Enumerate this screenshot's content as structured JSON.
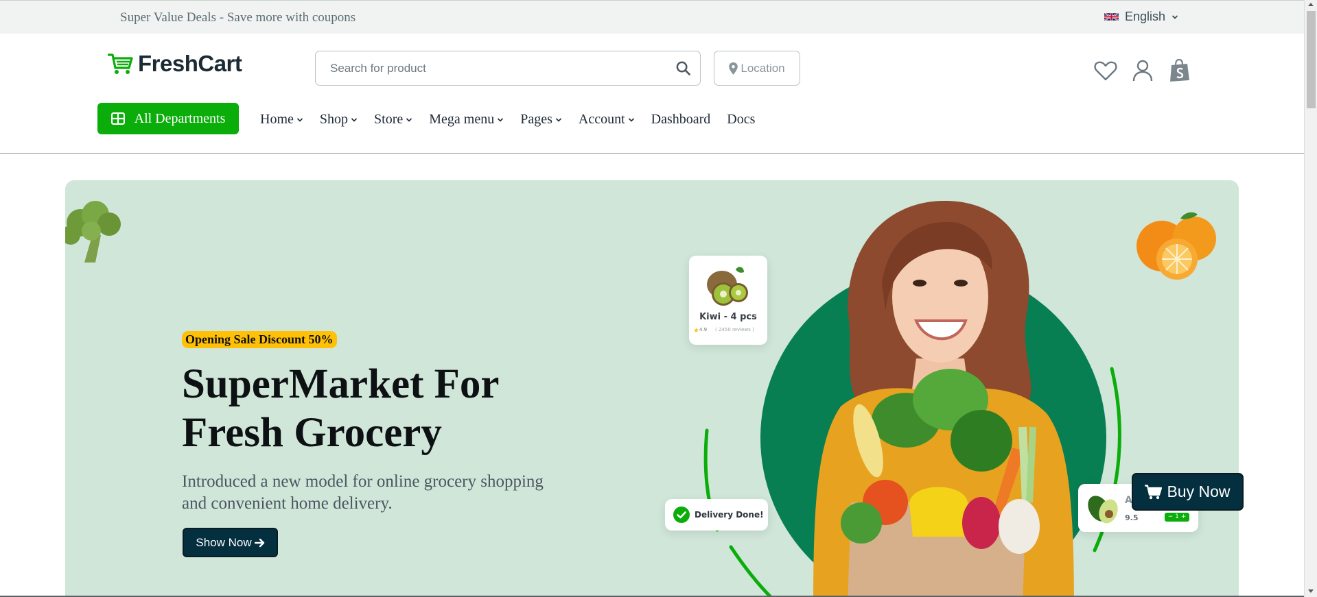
{
  "topbar": {
    "promo_text": "Super Value Deals - Save more with coupons",
    "language": "English"
  },
  "header": {
    "brand": "FreshCart",
    "search_placeholder": "Search for product",
    "location_label": "Location",
    "icons": [
      "heart-icon",
      "user-icon",
      "shopping-bag-icon"
    ]
  },
  "nav": {
    "departments_label": "All Departments",
    "items": [
      {
        "label": "Home",
        "has_dropdown": true
      },
      {
        "label": "Shop",
        "has_dropdown": true
      },
      {
        "label": "Store",
        "has_dropdown": true
      },
      {
        "label": "Mega menu",
        "has_dropdown": true
      },
      {
        "label": "Pages",
        "has_dropdown": true
      },
      {
        "label": "Account",
        "has_dropdown": true
      },
      {
        "label": "Dashboard",
        "has_dropdown": false
      },
      {
        "label": "Docs",
        "has_dropdown": false
      }
    ]
  },
  "hero": {
    "badge": "Opening Sale Discount 50%",
    "title_line1": "SuperMarket For",
    "title_line2": "Fresh Grocery",
    "subtitle_line1": "Introduced a new model for online grocery shopping",
    "subtitle_line2": "and convenient home delivery.",
    "cta_label": "Show Now",
    "kiwi_card": {
      "name": "Kiwi - 4 pcs",
      "rating": "4.9",
      "reviews": "( 2450 reviews )"
    },
    "delivery_card": {
      "text": "Delivery Done!"
    },
    "avocado_card": {
      "label": "A",
      "price": "9.5",
      "qty": "−  1  +"
    }
  },
  "floating": {
    "buy_now_label": "Buy Now"
  },
  "colors": {
    "brand_green": "#0aad0a",
    "dark_navy": "#032f3e",
    "hero_bg": "#d0e6d9",
    "badge_yellow": "#ffc107"
  }
}
